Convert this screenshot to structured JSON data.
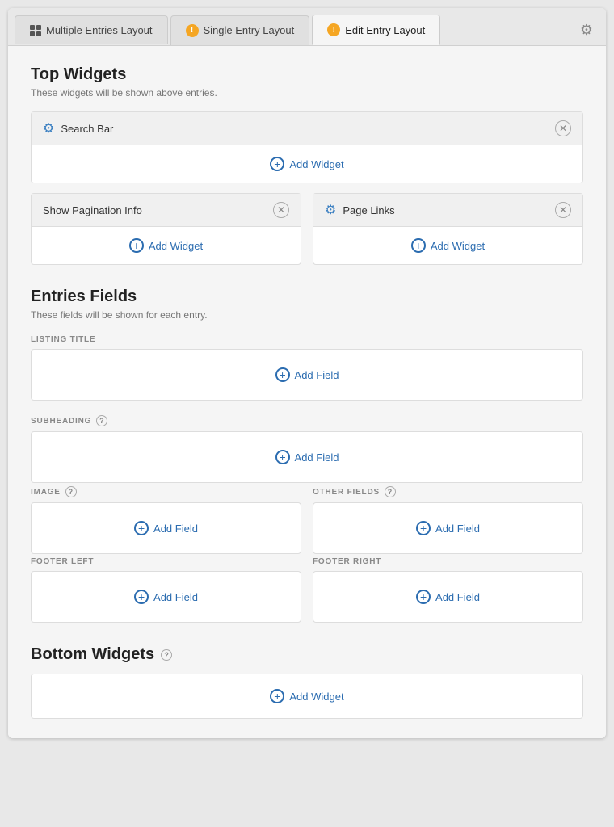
{
  "tabs": [
    {
      "id": "multiple",
      "label": "Multiple Entries Layout",
      "icon": "grid",
      "active": false
    },
    {
      "id": "single",
      "label": "Single Entry Layout",
      "icon": "warning",
      "active": false
    },
    {
      "id": "edit",
      "label": "Edit Entry Layout",
      "icon": "warning",
      "active": true
    }
  ],
  "top_widgets": {
    "title": "Top Widgets",
    "subtitle": "These widgets will be shown above entries.",
    "full_width": [
      {
        "name": "Search Bar"
      }
    ],
    "add_widget_label": "Add Widget",
    "two_col": [
      {
        "name": "Show Pagination Info"
      },
      {
        "name": "Page Links"
      }
    ],
    "add_widget_label_left": "Add Widget",
    "add_widget_label_right": "Add Widget"
  },
  "entries_fields": {
    "title": "Entries Fields",
    "subtitle": "These fields will be shown for each entry.",
    "fields": [
      {
        "id": "listing_title",
        "label": "LISTING TITLE",
        "has_help": false,
        "add_label": "Add Field"
      },
      {
        "id": "subheading",
        "label": "SUBHEADING",
        "has_help": true,
        "add_label": "Add Field"
      }
    ],
    "two_col_fields": [
      {
        "id": "image",
        "label": "IMAGE",
        "has_help": true,
        "add_label": "Add Field"
      },
      {
        "id": "other_fields",
        "label": "OTHER FIELDS",
        "has_help": true,
        "add_label": "Add Field"
      }
    ],
    "footer_fields": [
      {
        "id": "footer_left",
        "label": "FOOTER LEFT",
        "has_help": false,
        "add_label": "Add Field"
      },
      {
        "id": "footer_right",
        "label": "FOOTER RIGHT",
        "has_help": false,
        "add_label": "Add Field"
      }
    ]
  },
  "bottom_widgets": {
    "title": "Bottom Widgets",
    "has_help": true,
    "add_widget_label": "Add Widget"
  }
}
